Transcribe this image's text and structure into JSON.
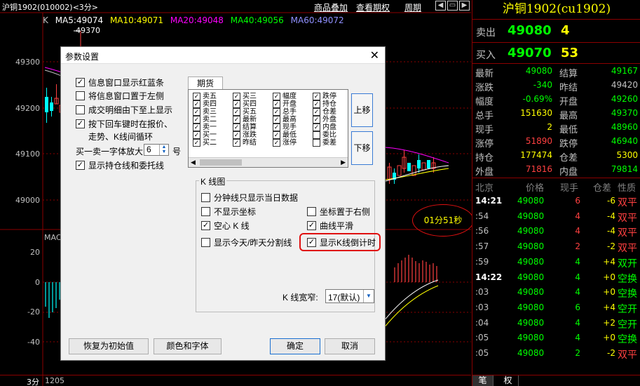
{
  "window": {
    "title": "沪铜1902(010002)<3分>",
    "links": [
      "商品叠加",
      "查看期权",
      "周期"
    ]
  },
  "chart": {
    "type_label": "K",
    "ma": [
      {
        "label": "MA5:49074",
        "color": "#ffffff"
      },
      {
        "label": "MA10:49071",
        "color": "#ffff00"
      },
      {
        "label": "MA20:49048",
        "color": "#ff00ff"
      },
      {
        "label": "MA40:49056",
        "color": "#00ff00"
      },
      {
        "label": "MA60:49072",
        "color": "#9090ff"
      }
    ],
    "high_mark": "49370",
    "yticks": [
      "49300",
      "49200",
      "49100",
      "49000"
    ],
    "macd_label": "MAC",
    "macd_yticks": [
      "20",
      "0",
      "-20",
      "-40"
    ],
    "countdown": "01分51秒",
    "period": "3分",
    "x_tick": "1205"
  },
  "dialog": {
    "title": "参数设置",
    "close": "✕",
    "options": [
      {
        "label": "信息窗口显示红蓝条",
        "checked": true
      },
      {
        "label": "将信息窗口置于左侧",
        "checked": false
      },
      {
        "label": "成交明细由下至上显示",
        "checked": false
      },
      {
        "label": "按下回车键时在报价、",
        "checked": true
      }
    ],
    "option_cont": "走势、K线间循环",
    "font_scale_label": "买一卖一字体放大",
    "font_scale_value": "6",
    "font_scale_unit": "号",
    "show_position": {
      "label": "显示持仓线和委托线",
      "checked": true
    },
    "futures_tab": "期货",
    "futures_columns": [
      [
        "卖五",
        "卖四",
        "卖三",
        "卖二",
        "卖一",
        "买一",
        "买二"
      ],
      [
        "买三",
        "买四",
        "买五",
        "最新",
        "结算",
        "涨跌",
        "昨结"
      ],
      [
        "幅度",
        "开盘",
        "总手",
        "最高",
        "现手",
        "最低",
        "涨停"
      ],
      [
        "跌停",
        "持仓",
        "仓差",
        "外盘",
        "内盘",
        "委比",
        "委差"
      ]
    ],
    "futures_checked_last": [
      true,
      true,
      true,
      true,
      true,
      false,
      false
    ],
    "move_up": "上移",
    "move_down": "下移",
    "kline_group_title": "K 线图",
    "kline_options": [
      {
        "label": "分钟线只显示当日数据",
        "checked": false
      },
      {
        "label": "不显示坐标",
        "checked": false
      },
      {
        "label": "坐标置于右侧",
        "checked": false
      },
      {
        "label": "空心 K 线",
        "checked": true
      },
      {
        "label": "曲线平滑",
        "checked": true
      },
      {
        "label": "显示今天/昨天分割线",
        "checked": false
      },
      {
        "label": "显示K线倒计时",
        "checked": true
      }
    ],
    "kline_width_label": "K 线宽窄:",
    "kline_width_value": "17(默认)",
    "restore_button": "恢复为初始值",
    "color_font_button": "颜色和字体",
    "ok_button": "确定",
    "cancel_button": "取消"
  },
  "quote": {
    "title": "沪铜1902(cu1902)",
    "sell": {
      "label": "卖出",
      "price": "49080",
      "volume": "4"
    },
    "buy": {
      "label": "买入",
      "price": "49070",
      "volume": "53"
    },
    "stats": [
      {
        "l1": "最新",
        "v1": "49080",
        "c1": "#00ff00",
        "l2": "结算",
        "v2": "49167",
        "c2": "#00ff00"
      },
      {
        "l1": "涨跌",
        "v1": "-340",
        "c1": "#00ff00",
        "l2": "昨结",
        "v2": "49420",
        "c2": "#c0c0c0"
      },
      {
        "l1": "幅度",
        "v1": "-0.69%",
        "c1": "#00ff00",
        "l2": "开盘",
        "v2": "49260",
        "c2": "#00ff00"
      },
      {
        "l1": "总手",
        "v1": "151630",
        "c1": "#ffff00",
        "l2": "最高",
        "v2": "49370",
        "c2": "#00ff00"
      },
      {
        "l1": "现手",
        "v1": "2",
        "c1": "#ffff00",
        "l2": "最低",
        "v2": "48960",
        "c2": "#00ff00"
      },
      {
        "l1": "涨停",
        "v1": "51890",
        "c1": "#ff4040",
        "l2": "跌停",
        "v2": "46940",
        "c2": "#00ff00"
      },
      {
        "l1": "持仓",
        "v1": "177474",
        "c1": "#ffff00",
        "l2": "仓差",
        "v2": "5300",
        "c2": "#ffff00"
      },
      {
        "l1": "外盘",
        "v1": "71816",
        "c1": "#ff4040",
        "l2": "内盘",
        "v2": "79814",
        "c2": "#00ff00"
      }
    ],
    "tick_header": [
      "北京",
      "价格",
      "现手",
      "仓差",
      "性质"
    ],
    "ticks": [
      {
        "time": "14:21",
        "major": true,
        "price": "49080",
        "vol": "6",
        "vol_color": "#ff4040",
        "chg": "-6",
        "chg_color": "#ffff00",
        "nature": "双平",
        "nature_color": "#ff4040"
      },
      {
        "time": ":54",
        "major": false,
        "price": "49080",
        "vol": "4",
        "vol_color": "#ff4040",
        "chg": "-4",
        "chg_color": "#ffff00",
        "nature": "双平",
        "nature_color": "#ff4040"
      },
      {
        "time": ":56",
        "major": false,
        "price": "49080",
        "vol": "4",
        "vol_color": "#ff4040",
        "chg": "-4",
        "chg_color": "#ffff00",
        "nature": "双平",
        "nature_color": "#ff4040"
      },
      {
        "time": ":57",
        "major": false,
        "price": "49080",
        "vol": "2",
        "vol_color": "#ff4040",
        "chg": "-2",
        "chg_color": "#ffff00",
        "nature": "双平",
        "nature_color": "#ff4040"
      },
      {
        "time": ":59",
        "major": false,
        "price": "49080",
        "vol": "4",
        "vol_color": "#00ff00",
        "chg": "+4",
        "chg_color": "#ffff00",
        "nature": "双开",
        "nature_color": "#00ff00"
      },
      {
        "time": "14:22",
        "major": true,
        "price": "49080",
        "vol": "4",
        "vol_color": "#00ff00",
        "chg": "+0",
        "chg_color": "#ffff00",
        "nature": "空换",
        "nature_color": "#00ff00"
      },
      {
        "time": ":03",
        "major": false,
        "price": "49080",
        "vol": "4",
        "vol_color": "#00ff00",
        "chg": "+0",
        "chg_color": "#ffff00",
        "nature": "空换",
        "nature_color": "#00ff00"
      },
      {
        "time": ":03",
        "major": false,
        "price": "49080",
        "vol": "6",
        "vol_color": "#00ff00",
        "chg": "+4",
        "chg_color": "#ffff00",
        "nature": "空开",
        "nature_color": "#00ff00"
      },
      {
        "time": ":04",
        "major": false,
        "price": "49080",
        "vol": "4",
        "vol_color": "#00ff00",
        "chg": "+2",
        "chg_color": "#ffff00",
        "nature": "空开",
        "nature_color": "#00ff00"
      },
      {
        "time": ":05",
        "major": false,
        "price": "49080",
        "vol": "4",
        "vol_color": "#00ff00",
        "chg": "+0",
        "chg_color": "#ffff00",
        "nature": "空换",
        "nature_color": "#00ff00"
      },
      {
        "time": ":05",
        "major": false,
        "price": "49080",
        "vol": "2",
        "vol_color": "#00ff00",
        "chg": "-2",
        "chg_color": "#ffff00",
        "nature": "双平",
        "nature_color": "#ff4040"
      }
    ],
    "tabs": [
      "笔",
      "权"
    ]
  }
}
